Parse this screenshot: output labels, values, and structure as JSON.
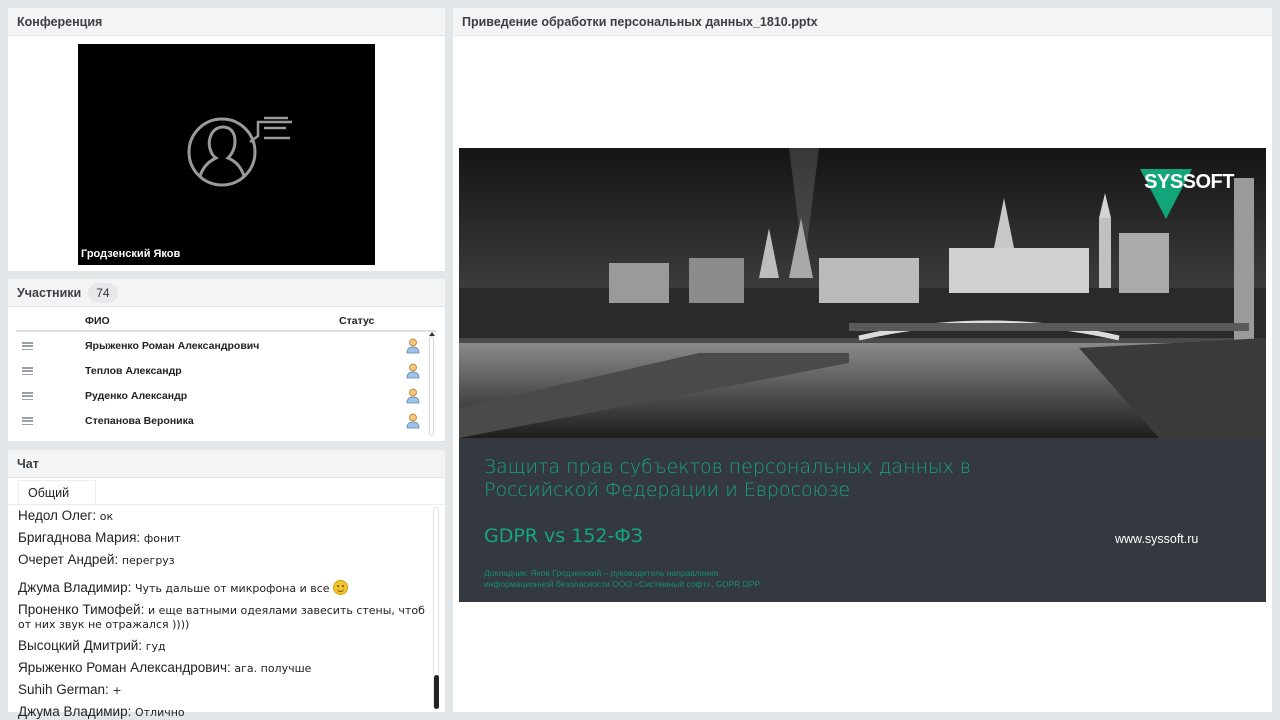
{
  "conference": {
    "title": "Конференция",
    "speaker_name": "Гродзенский Яков"
  },
  "participants": {
    "title": "Участники",
    "count": "74",
    "columns": {
      "name": "ФИО",
      "status": "Статус"
    },
    "rows": [
      {
        "name": "Ярыженко Роман  Александрович"
      },
      {
        "name": "Теплов Александр"
      },
      {
        "name": "Руденко Александр"
      },
      {
        "name": "Степанова Вероника"
      }
    ]
  },
  "chat": {
    "title": "Чат",
    "tab": "Общий",
    "messages": [
      {
        "author": "Недол Олег:",
        "text": "ок"
      },
      {
        "author": "Бригаднова Мария:",
        "text": "фонит"
      },
      {
        "author": "Очерет Андрей:",
        "text": "перегруз"
      },
      {
        "author": "Джума Владимир:",
        "text": "Чуть дальше от микрофона и все"
      },
      {
        "author": "Проненко Тимофей:",
        "text": "и еще ватными одеялами завесить стены, чтоб от них звук не отражался ))))"
      },
      {
        "author": "Высоцкий Дмитрий:",
        "text": "гуд"
      },
      {
        "author": "Ярыженко Роман  Александрович:",
        "text": "ага. получше"
      },
      {
        "author": "Suhih German:",
        "text": "+"
      },
      {
        "author": "Джума Владимир:",
        "text": "Отлично"
      }
    ]
  },
  "presentation": {
    "title": "Приведение обработки персональных данных_1810.pptx",
    "slide": {
      "logo": "SYSSOFT",
      "title_line1": "Защита прав субъектов персональных данных в",
      "title_line2": "Российской Федерации и Евросоюзе",
      "subtitle": "GDPR vs 152-ФЗ",
      "url": "www.syssoft.ru",
      "speaker_line1": "Докладчик: Яков Гродзенский – руководитель направления",
      "speaker_line2": "информационной безопасности ООО «Системный софт», GDPR DPP"
    }
  },
  "colors": {
    "accent_green": "#16a67c",
    "slide_dark": "#33393e",
    "panel_bg": "#ffffff",
    "page_bg": "#e4e7ea"
  }
}
